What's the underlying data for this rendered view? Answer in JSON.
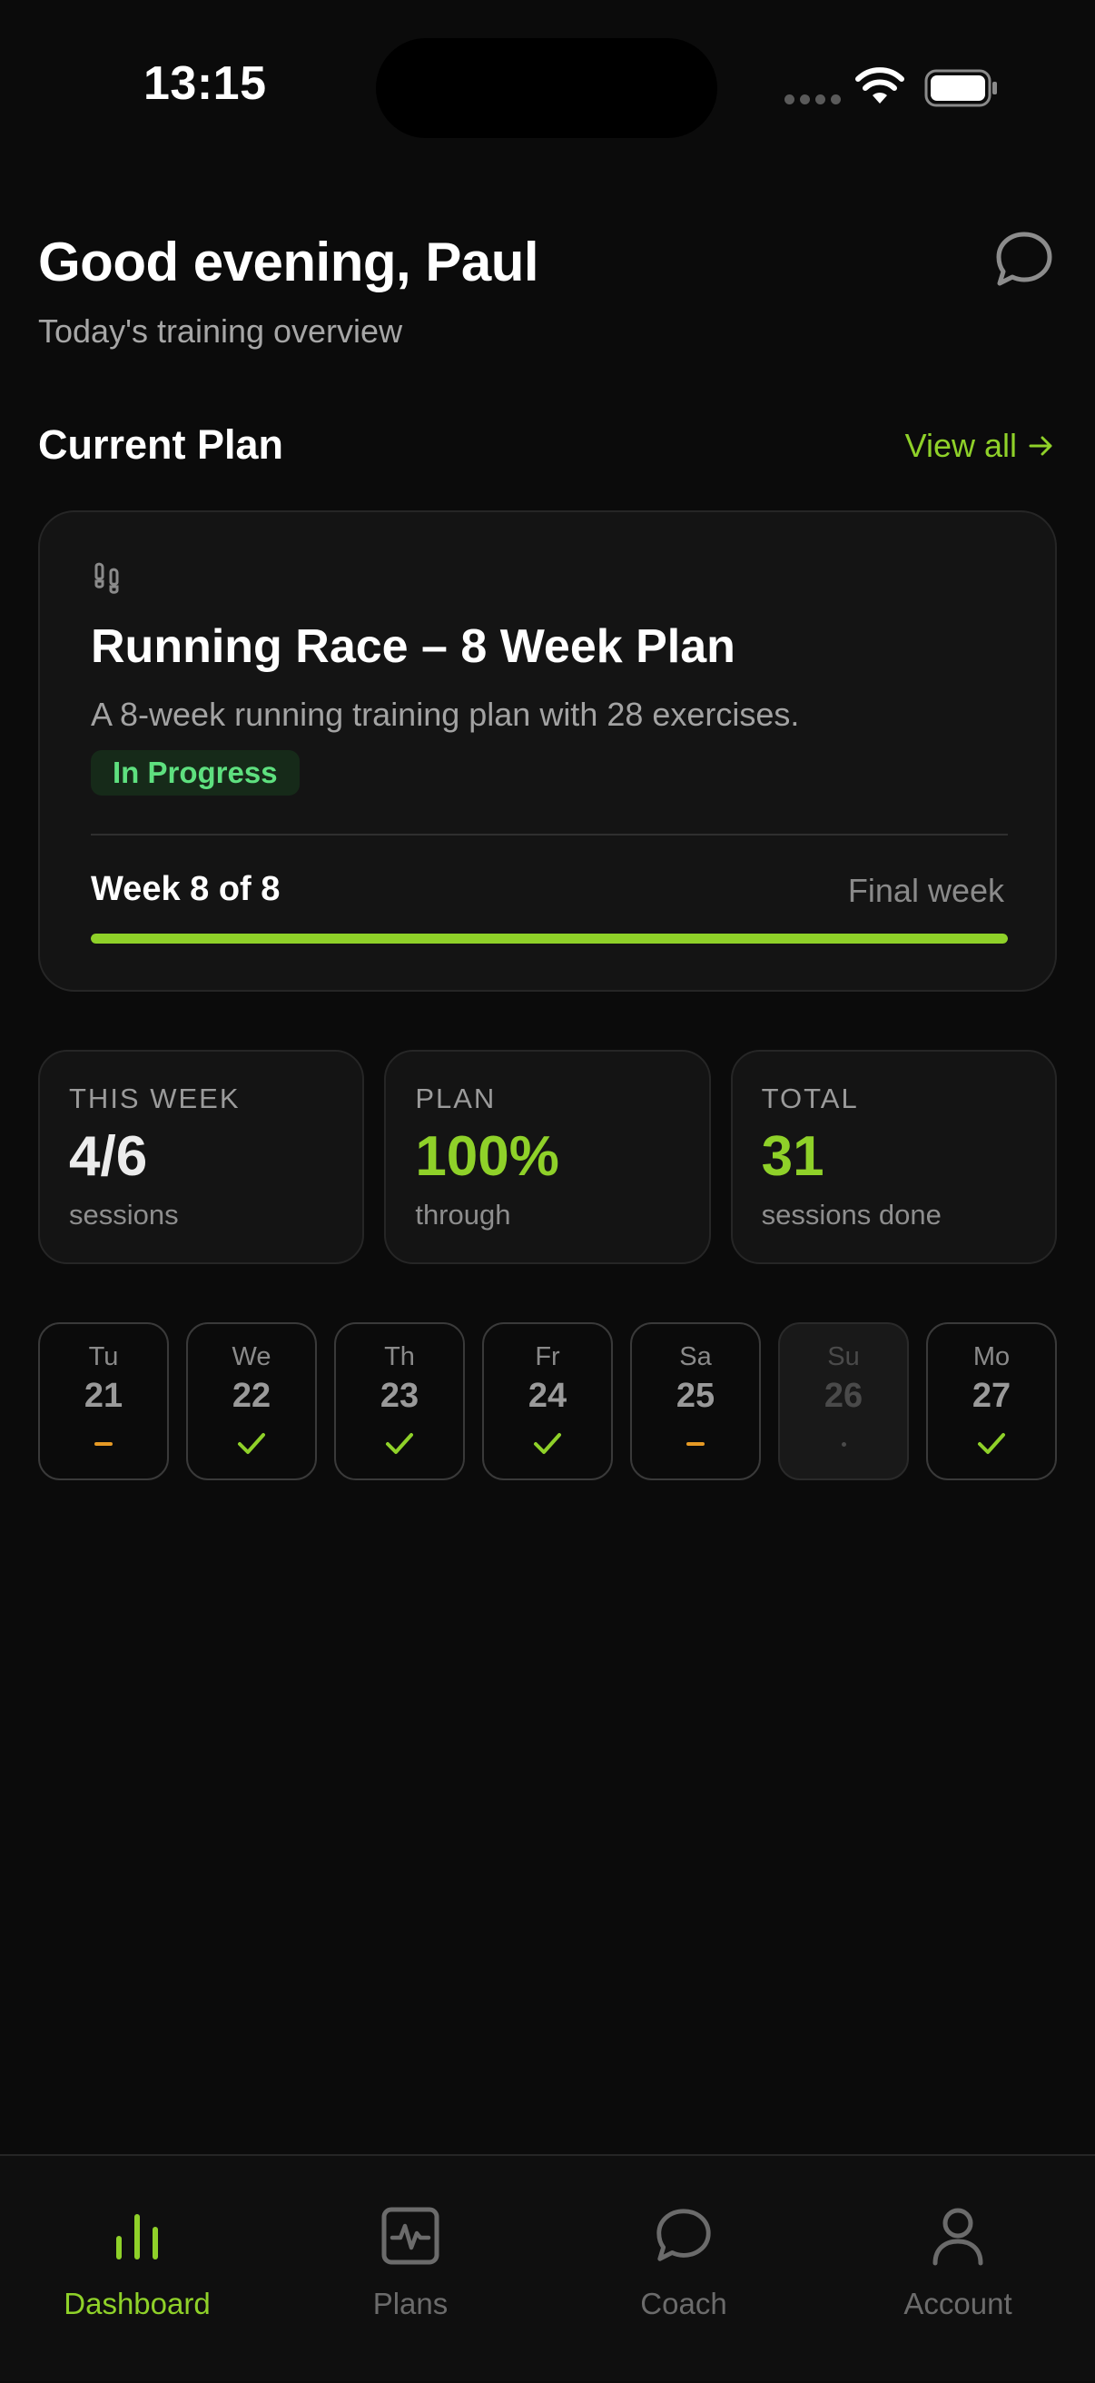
{
  "status_bar": {
    "time": "13:15"
  },
  "header": {
    "greeting": "Good evening, Paul",
    "subtitle": "Today's training overview"
  },
  "current_plan": {
    "section_title": "Current Plan",
    "view_all": "View all",
    "card": {
      "icon": "footprints-icon",
      "title": "Running Race – 8 Week Plan",
      "description": "A 8-week running training plan with 28 exercises.",
      "status": "In Progress",
      "week_label": "Week 8 of 8",
      "week_note": "Final week",
      "progress_fraction": 1.0
    }
  },
  "stats": [
    {
      "label": "THIS WEEK",
      "value": "4/6",
      "sub": "sessions",
      "accent": false
    },
    {
      "label": "PLAN",
      "value": "100%",
      "sub": "through",
      "accent": true
    },
    {
      "label": "TOTAL",
      "value": "31",
      "sub": "sessions done",
      "accent": true
    }
  ],
  "days": [
    {
      "name": "Tu",
      "num": "21",
      "mark": "partial"
    },
    {
      "name": "We",
      "num": "22",
      "mark": "done"
    },
    {
      "name": "Th",
      "num": "23",
      "mark": "done"
    },
    {
      "name": "Fr",
      "num": "24",
      "mark": "done"
    },
    {
      "name": "Sa",
      "num": "25",
      "mark": "partial"
    },
    {
      "name": "Su",
      "num": "26",
      "mark": "none"
    },
    {
      "name": "Mo",
      "num": "27",
      "mark": "done"
    }
  ],
  "nav": [
    {
      "label": "Dashboard",
      "icon": "bar-chart-icon",
      "active": true
    },
    {
      "label": "Plans",
      "icon": "activity-square-icon",
      "active": false
    },
    {
      "label": "Coach",
      "icon": "chat-bubble-icon",
      "active": false
    },
    {
      "label": "Account",
      "icon": "user-icon",
      "active": false
    }
  ],
  "colors": {
    "accent": "#8fd129",
    "badge_text": "#5ee07f",
    "badge_bg": "#162a19",
    "partial": "#e69a25",
    "background": "#0b0b0b"
  }
}
